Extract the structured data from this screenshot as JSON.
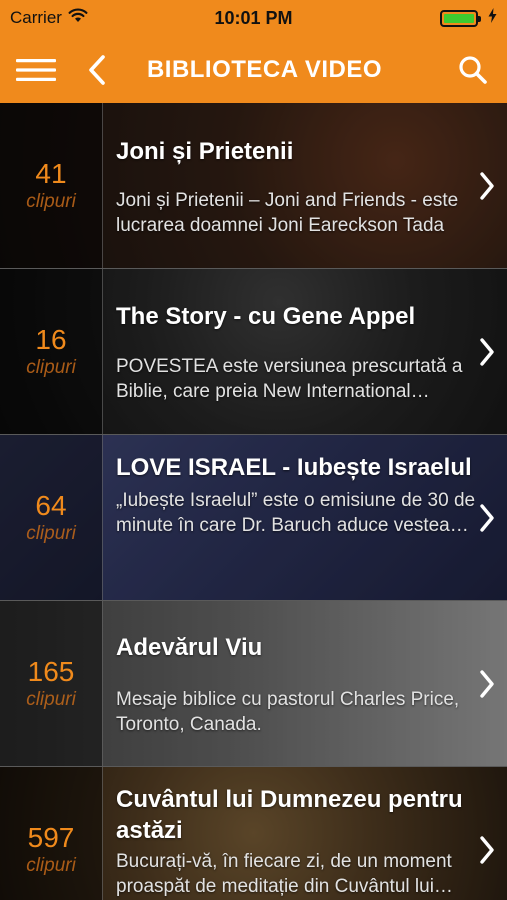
{
  "status_bar": {
    "carrier": "Carrier",
    "time": "10:01 PM",
    "battery_level": 1.0
  },
  "nav": {
    "title": "BIBLIOTECA VIDEO",
    "menu_icon": "hamburger-icon",
    "back_icon": "chevron-left-icon",
    "search_icon": "search-icon"
  },
  "colors": {
    "accent": "#f08a1c",
    "battery": "#3ecb2f"
  },
  "list": {
    "items": [
      {
        "count": "41",
        "count_label": "clipuri",
        "title": "Joni și Prietenii",
        "description": "Joni și Prietenii – Joni and Friends - este lucrarea doamnei Joni Eareckson Tada"
      },
      {
        "count": "16",
        "count_label": "clipuri",
        "title": "The Story - cu Gene Appel",
        "description": "POVESTEA este versiunea prescurtată a Biblie, care preia New International Version"
      },
      {
        "count": "64",
        "count_label": "clipuri",
        "title": "LOVE ISRAEL - Iubește Israelul",
        "description": "„Iubește Israelul” este o emisiune de 30 de minute în care Dr. Baruch aduce vestea bună"
      },
      {
        "count": "165",
        "count_label": "clipuri",
        "title": "Adevărul Viu",
        "description": "Mesaje biblice cu pastorul Charles Price, Toronto, Canada."
      },
      {
        "count": "597",
        "count_label": "clipuri",
        "title": "Cuvântul lui Dumnezeu pentru astăzi",
        "description": "Bucurați-vă, în fiecare zi, de un moment proaspăt de meditație din Cuvântul lui Dumnezeu"
      }
    ]
  }
}
